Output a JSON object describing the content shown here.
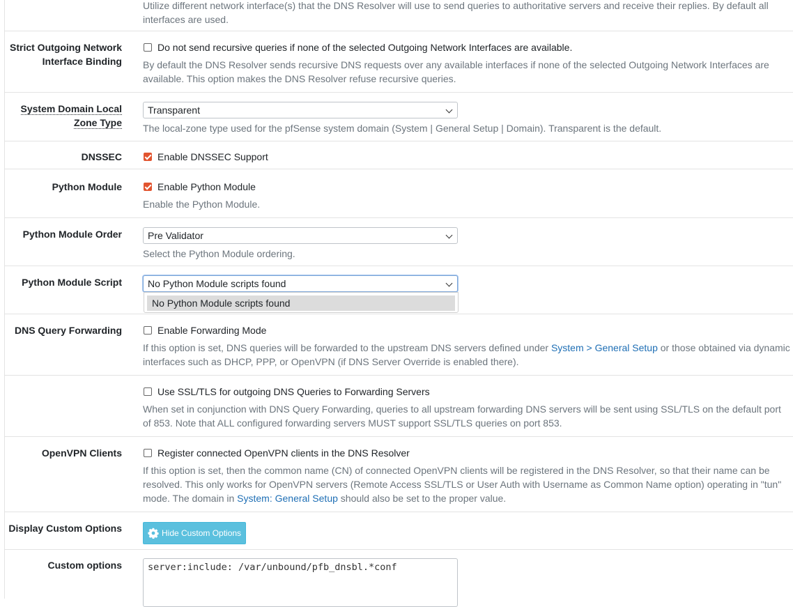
{
  "outgoing_interfaces": {
    "help": "Utilize different network interface(s) that the DNS Resolver will use to send queries to authoritative servers and receive their replies. By default all interfaces are used."
  },
  "strict_outgoing": {
    "label_line1": "Strict Outgoing Network",
    "label_line2": "Interface Binding",
    "checkbox_label": "Do not send recursive queries if none of the selected Outgoing Network Interfaces are available.",
    "checked": false,
    "help": "By default the DNS Resolver sends recursive DNS requests over any available interfaces if none of the selected Outgoing Network Interfaces are available. This option makes the DNS Resolver refuse recursive queries."
  },
  "system_domain_zone": {
    "label_line1": "System Domain Local",
    "label_line2": "Zone Type",
    "selected": "Transparent",
    "help": "The local-zone type used for the pfSense system domain (System | General Setup | Domain). Transparent is the default."
  },
  "dnssec": {
    "label": "DNSSEC",
    "checkbox_label": "Enable DNSSEC Support",
    "checked": true
  },
  "python_module": {
    "label": "Python Module",
    "checkbox_label": "Enable Python Module",
    "checked": true,
    "help": "Enable the Python Module."
  },
  "python_module_order": {
    "label": "Python Module Order",
    "selected": "Pre Validator",
    "help": "Select the Python Module ordering."
  },
  "python_module_script": {
    "label": "Python Module Script",
    "selected": "No Python Module scripts found",
    "options": [
      "No Python Module scripts found"
    ]
  },
  "dns_query_forwarding": {
    "label": "DNS Query Forwarding",
    "checkbox_label": "Enable Forwarding Mode",
    "checked": false,
    "help_before": "If this option is set, DNS queries will be forwarded to the upstream DNS servers defined under ",
    "help_link": "System > General Setup",
    "help_after": " or those obtained via dynamic interfaces such as DHCP, PPP, or OpenVPN (if DNS Server Override is enabled there)."
  },
  "ssl_tls_forwarding": {
    "checkbox_label": "Use SSL/TLS for outgoing DNS Queries to Forwarding Servers",
    "checked": false,
    "help": "When set in conjunction with DNS Query Forwarding, queries to all upstream forwarding DNS servers will be sent using SSL/TLS on the default port of 853. Note that ALL configured forwarding servers MUST support SSL/TLS queries on port 853."
  },
  "openvpn_clients": {
    "label": "OpenVPN Clients",
    "checkbox_label": "Register connected OpenVPN clients in the DNS Resolver",
    "checked": false,
    "help_before": "If this option is set, then the common name (CN) of connected OpenVPN clients will be registered in the DNS Resolver, so that their name can be resolved. This only works for OpenVPN servers (Remote Access SSL/TLS or User Auth with Username as Common Name option) operating in \"tun\" mode. The domain in ",
    "help_link": "System: General Setup",
    "help_after": " should also be set to the proper value."
  },
  "display_custom_options": {
    "label": "Display Custom Options",
    "button_label": "Hide Custom Options",
    "button_icon": "gear-icon",
    "button_color": "#5bc0de"
  },
  "custom_options": {
    "label": "Custom options",
    "value": "server:include: /var/unbound/pfb_dnsbl.*conf"
  },
  "colors": {
    "checkbox_checked": "#e2542f",
    "link": "#1f6fb5"
  }
}
